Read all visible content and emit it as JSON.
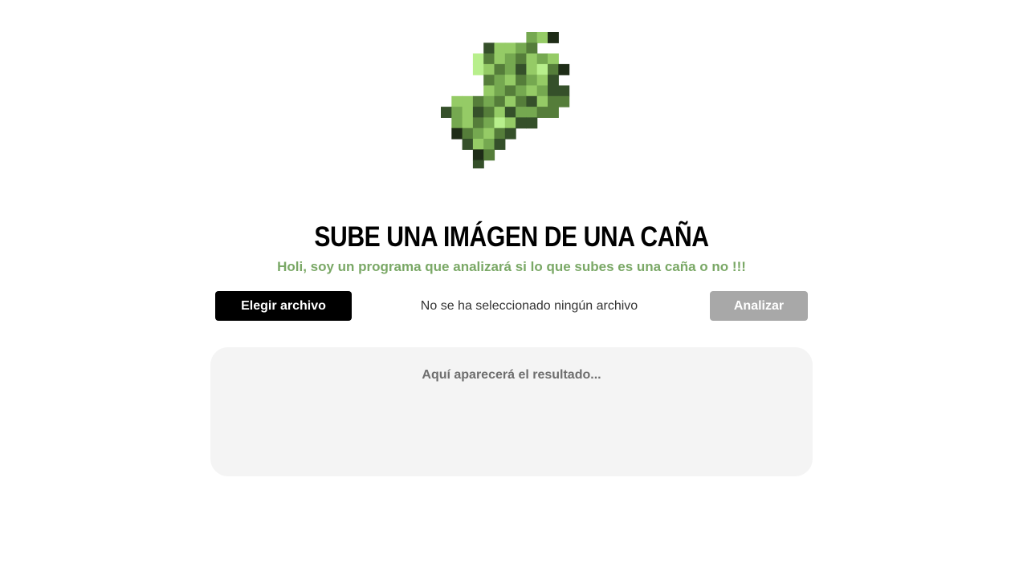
{
  "header": {
    "logo_icon": "sugar-cane-pixel-icon",
    "title": "SUBE UNA IMÁGEN DE UNA CAÑA",
    "subtitle": "Holi, soy un programa que analizará si lo que subes es una caña o no !!!"
  },
  "upload": {
    "choose_label": "Elegir archivo",
    "file_status": "No se ha seleccionado ningún archivo",
    "analyze_label": "Analizar"
  },
  "result": {
    "placeholder": "Aquí aparecerá el resultado..."
  },
  "colors": {
    "subtitle": "#7aa866",
    "choose_button_bg": "#000000",
    "analyze_button_bg": "#a8a8a8",
    "result_box_bg": "#f4f4f4"
  }
}
